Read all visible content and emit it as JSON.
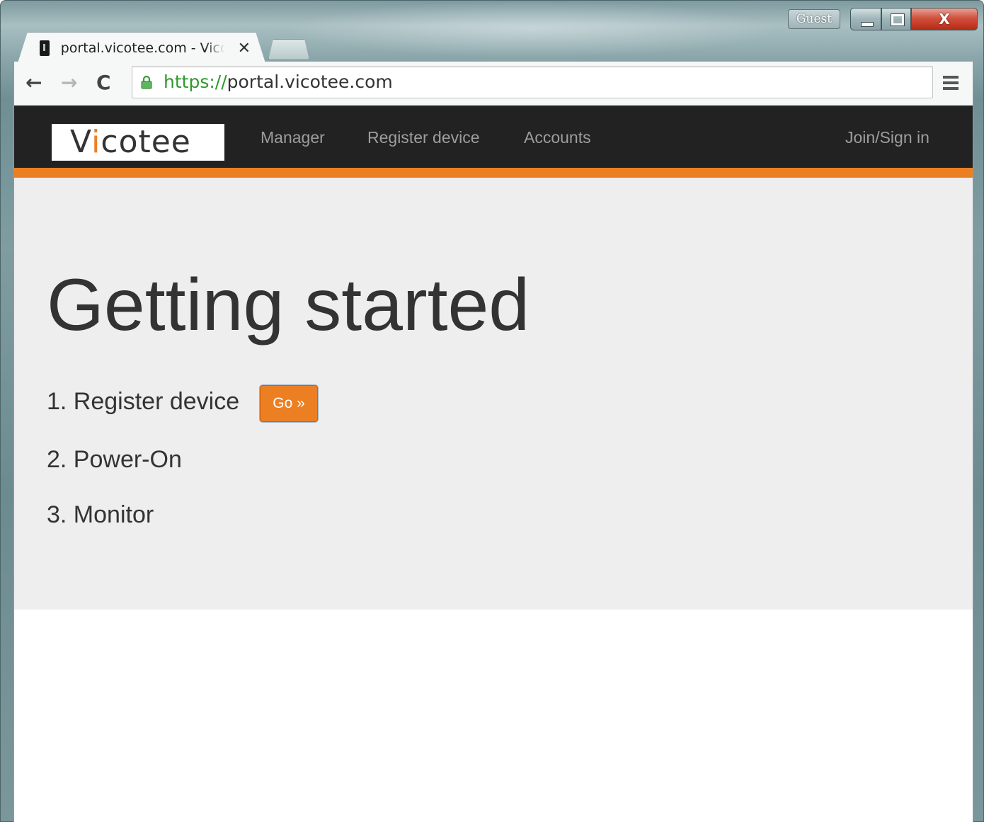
{
  "browser": {
    "guest_label": "Guest",
    "close_glyph": "X",
    "tab": {
      "title": "portal.vicotee.com - Vicotee",
      "close_glyph": "✕"
    },
    "toolbar": {
      "back_glyph": "←",
      "forward_glyph": "→",
      "reload_glyph": "C",
      "url_scheme": "https://",
      "url_host": "portal.vicotee.com"
    }
  },
  "site": {
    "logo": {
      "prefix": "V",
      "accent": "i",
      "suffix": "cotee"
    },
    "nav": {
      "manager": "Manager",
      "register_device": "Register device",
      "accounts": "Accounts",
      "join_sign_in": "Join/Sign in"
    },
    "colors": {
      "navbar": "#222222",
      "accent": "#ed7f23",
      "jumbotron": "#eeeeee"
    }
  },
  "main": {
    "title": "Getting started",
    "steps": [
      "1. Register device",
      "2. Power-On",
      "3. Monitor"
    ],
    "go_button": "Go »"
  },
  "icons": {
    "favicon": "vicotee-favicon-icon",
    "lock": "lock-icon",
    "menu": "hamburger-menu-icon"
  }
}
